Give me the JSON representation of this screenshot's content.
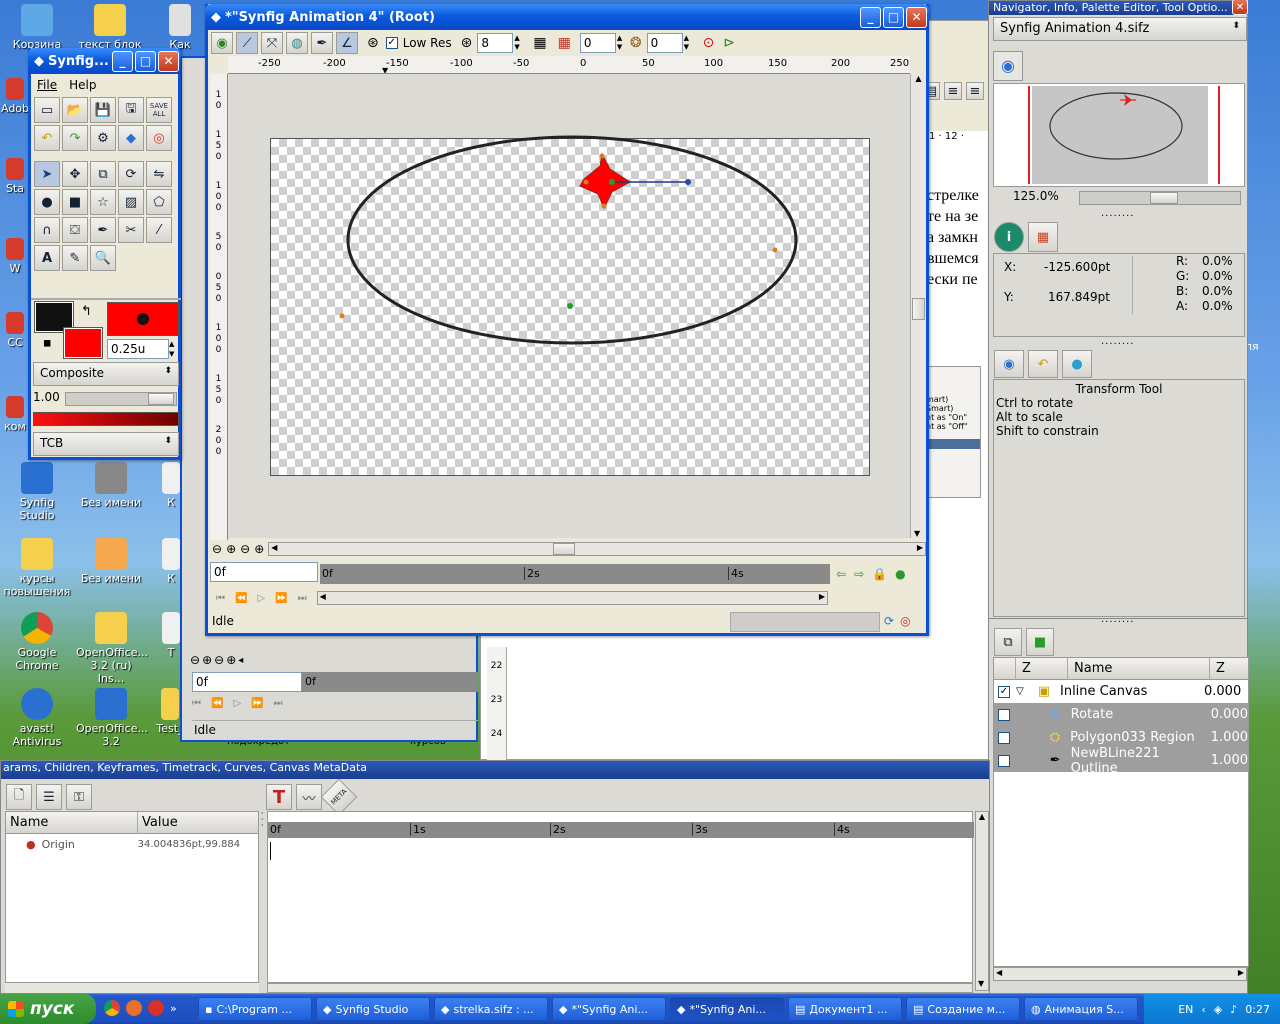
{
  "desktop": {
    "icons": [
      {
        "label": "Корзина",
        "color": "#5fa8e6"
      },
      {
        "label": "текст блок",
        "color": "#f5d04d"
      },
      {
        "label": "Как",
        "color": "#e0e0e0"
      },
      {
        "label": "Adob",
        "color": "#d43b2b"
      },
      {
        "label": "Sta",
        "color": "#d43b2b"
      },
      {
        "label": "W",
        "color": "#d43b2b"
      },
      {
        "label": "CC",
        "color": "#d43b2b"
      },
      {
        "label": "ком",
        "color": "#d43b2b"
      },
      {
        "label": "Synfig Studio",
        "color": "#2a70d0"
      },
      {
        "label": "Без имени",
        "color": "#888888"
      },
      {
        "label": "К",
        "color": "#f0f0f0"
      },
      {
        "label": "курсы повышения",
        "color": "#f5d04d"
      },
      {
        "label": "Без имени",
        "color": "#f5a84d"
      },
      {
        "label": "К",
        "color": "#f0f0f0"
      },
      {
        "label": "Google Chrome",
        "color": "#4caf50"
      },
      {
        "label": "OpenOffice... 3.2 (ru) Ins...",
        "color": "#f5d04d"
      },
      {
        "label": "Т",
        "color": "#f0f0f0"
      },
      {
        "label": "avast! Antivirus",
        "color": "#2a70d0"
      },
      {
        "label": "OpenOffice... 3.2",
        "color": "#2a70d0"
      },
      {
        "label": "Test_",
        "color": "#f5d04d"
      }
    ]
  },
  "toolbox": {
    "title": "Synfig...",
    "menu": [
      "File",
      "Help"
    ],
    "outline_color": "#111111",
    "fill_color": "#ff0000",
    "width_value": "0.25u",
    "blend_method": "Composite",
    "amount": "1.00",
    "gradient_interp": "TCB",
    "icons_row1": [
      "new-icon",
      "open-icon",
      "save-icon",
      "save-as-icon",
      "save-all-icon"
    ],
    "save_all_label": "SAVE ALL",
    "icons_row2": [
      "undo-icon",
      "redo-icon",
      "setup-icon",
      "synfig-icon",
      "help-icon"
    ],
    "tools": [
      "transform-tool-icon",
      "smooth-move-tool-icon",
      "scale-tool-icon",
      "rotate-tool-icon",
      "mirror-tool-icon",
      "circle-tool-icon",
      "rectangle-tool-icon",
      "star-tool-icon",
      "gradient-tool-icon",
      "polygon-tool-icon",
      "spline-tool-icon",
      "fill-tool-icon",
      "draw-tool-icon",
      "cutout-tool-icon",
      "eyedrop-tool-icon",
      "text-tool-icon",
      "sketch-tool-icon",
      "zoom-tool-icon"
    ]
  },
  "canvas_window": {
    "title": "*\"Synfig Animation 4\" (Root)",
    "low_res_label": "Low Res",
    "low_res_checked": true,
    "grid_size": "8",
    "onion_past": "0",
    "onion_future": "0",
    "ruler_h_ticks": [
      "-250",
      "-200",
      "-150",
      "-100",
      "-50",
      "0",
      "50",
      "100",
      "150",
      "200",
      "250"
    ],
    "ruler_v_ticks": [
      "1",
      "0",
      "1",
      "5",
      "0",
      "1",
      "0",
      "0",
      "5",
      "0",
      "0",
      "5",
      "0",
      "1",
      "0",
      "0",
      "1",
      "5",
      "0",
      "2",
      "0",
      "0"
    ],
    "time_field": "0f",
    "timebar_labels": [
      "0f",
      "2s",
      "4s"
    ],
    "status": "Idle"
  },
  "back_canvas": {
    "time_field": "0f",
    "timebar_label": "0f",
    "status": "Idle",
    "ruler_v": [
      "22",
      "23",
      "24"
    ]
  },
  "document_text": {
    "lines": [
      "стрелке",
      "те на зе",
      "а замкн",
      "вшемся",
      "ески пе"
    ],
    "ruler": "1 · 12 ·",
    "menu_lines": [
      "mart)",
      "Smart)",
      "nt as \"On\"",
      "nt as \"Off\""
    ],
    "footer": [
      "подохредот",
      "курсов"
    ]
  },
  "navigator": {
    "title": "Navigator, Info, Palette Editor, Tool Optio...",
    "file": "Synfig Animation 4.sifz",
    "zoom": "125.0%"
  },
  "info": {
    "x_label": "X:",
    "x_value": "-125.600pt",
    "y_label": "Y:",
    "y_value": "167.849pt",
    "r_label": "R:",
    "r_value": "0.0%",
    "g_label": "G:",
    "g_value": "0.0%",
    "b_label": "B:",
    "b_value": "0.0%",
    "a_label": "A:",
    "a_value": "0.0%"
  },
  "tool_options": {
    "heading": "Transform Tool",
    "lines": [
      "Ctrl to rotate",
      "Alt to scale",
      "Shift to constrain"
    ]
  },
  "layers": {
    "columns": [
      "Z",
      "Name",
      "Z"
    ],
    "rows": [
      {
        "name": "Inline Canvas",
        "z": "0.000",
        "checked": true,
        "icon": "folder-icon",
        "expanded": true
      },
      {
        "name": "Rotate",
        "z": "0.000",
        "checked": true,
        "icon": "rotate-layer-icon"
      },
      {
        "name": "Polygon033 Region",
        "z": "1.000",
        "checked": true,
        "icon": "region-layer-icon"
      },
      {
        "name": "NewBLine221 Outline",
        "z": "1.000",
        "checked": true,
        "icon": "outline-layer-icon"
      }
    ]
  },
  "params": {
    "title": "arams, Children, Keyframes, Timetrack, Curves, Canvas MetaData",
    "columns": [
      "Name",
      "Value"
    ],
    "rows": [
      {
        "name": "Origin",
        "value": "34.004836pt,99.884"
      }
    ],
    "timetrack_labels": [
      "0f",
      "1s",
      "2s",
      "3s",
      "4s"
    ],
    "meta_label": "META"
  },
  "taskbar": {
    "start": "пуск",
    "tasks": [
      "C:\\Program ...",
      "Synfig Studio",
      "strelka.sifz : ...",
      "*\"Synfig Ani...",
      "*\"Synfig Ani...",
      "Документ1 ...",
      "Создание м...",
      "Анимация S..."
    ],
    "lang": "EN",
    "clock": "0:27"
  },
  "colors": {
    "xp_blue": "#0a5ce0",
    "accent_red": "#ff0000"
  }
}
